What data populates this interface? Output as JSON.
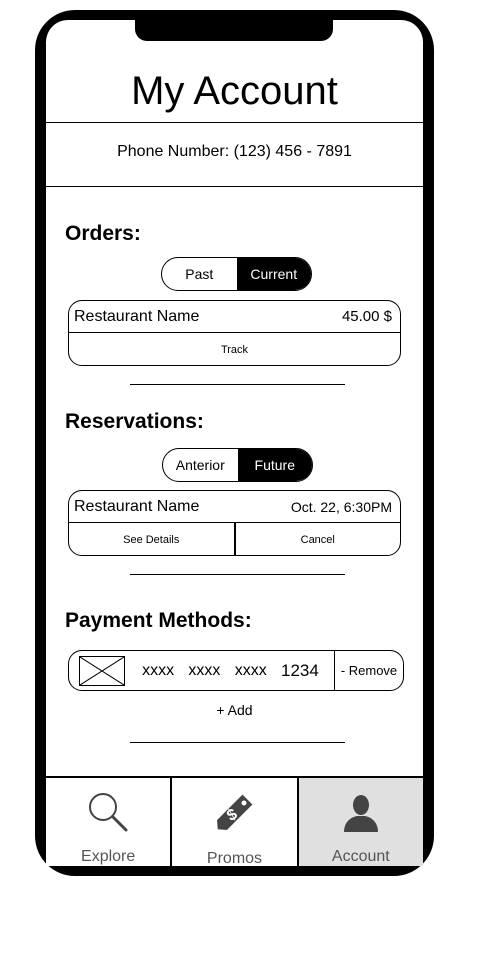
{
  "header": {
    "title": "My Account"
  },
  "phone_line": "Phone Number: (123) 456 - 7891",
  "orders": {
    "title": "Orders:",
    "toggle": [
      {
        "label": "Past",
        "active": false
      },
      {
        "label": "Current",
        "active": true
      }
    ],
    "card": {
      "name": "Restaurant Name",
      "value": "45.00 $",
      "action": "Track"
    }
  },
  "reservations": {
    "title": "Reservations:",
    "toggle": [
      {
        "label": "Anterior",
        "active": false
      },
      {
        "label": "Future",
        "active": true
      }
    ],
    "card": {
      "name": "Restaurant Name",
      "value": "Oct. 22, 6:30PM",
      "actions": [
        "See Details",
        "Cancel"
      ]
    }
  },
  "payment": {
    "title": "Payment Methods:",
    "card_number": [
      "xxxx",
      "xxxx",
      "xxxx",
      "1234"
    ],
    "remove_label": "- Remove",
    "add_label": "+ Add"
  },
  "tabbar": {
    "items": [
      {
        "label": "Explore",
        "icon": "search-icon",
        "active": false
      },
      {
        "label": "Promos",
        "icon": "price-tag-icon",
        "active": false
      },
      {
        "label": "Account",
        "icon": "user-icon",
        "active": true
      }
    ]
  },
  "colors": {
    "active_toggle": "#000000",
    "active_tab_bg": "#e0e0e0",
    "tab_label": "#555555"
  }
}
